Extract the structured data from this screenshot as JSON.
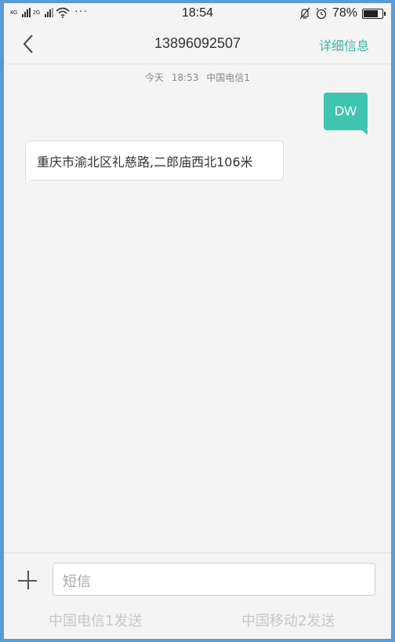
{
  "status_bar": {
    "network_1": "4G",
    "network_2": "2G",
    "more_indicator": "···",
    "time": "18:54",
    "battery_percent": "78%",
    "battery_level": 0.78,
    "icons": [
      "signal-icon",
      "wifi-icon",
      "mute-icon",
      "alarm-icon",
      "battery-icon"
    ]
  },
  "header": {
    "title": "13896092507",
    "details_label": "详细信息"
  },
  "conversation": {
    "timestamp_day": "今天",
    "timestamp_time": "18:53",
    "timestamp_carrier": "中国电信1",
    "messages": [
      {
        "direction": "outgoing",
        "text": "DW"
      },
      {
        "direction": "incoming",
        "text": "重庆市渝北区礼慈路,二郎庙西北106米"
      }
    ]
  },
  "composer": {
    "placeholder": "短信",
    "send_sim1_label": "中国电信1发送",
    "send_sim2_label": "中国移动2发送"
  },
  "colors": {
    "accent": "#3fb8a0",
    "outgoing_bubble": "#3fc4b0",
    "frame": "#5b9bd5"
  }
}
